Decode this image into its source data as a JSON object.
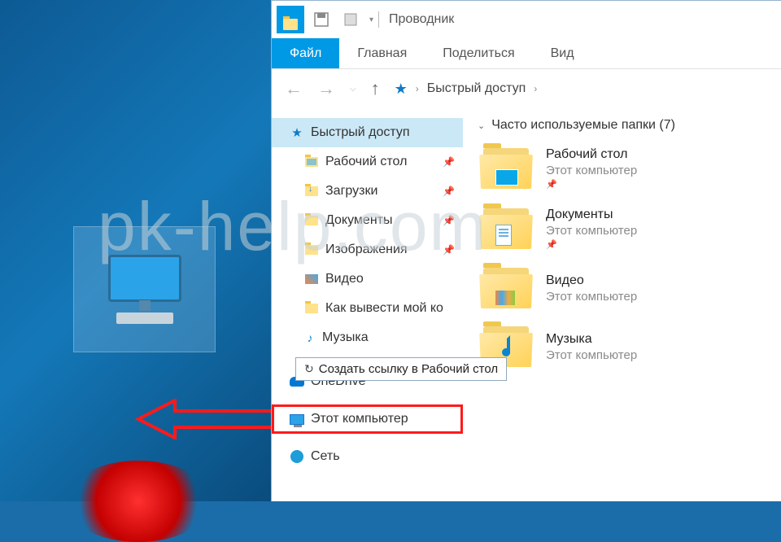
{
  "watermark": "pk-help.com",
  "titlebar": {
    "app_title": "Проводник"
  },
  "ribbon": {
    "file": "Файл",
    "home": "Главная",
    "share": "Поделиться",
    "view": "Вид"
  },
  "breadcrumb": {
    "root": "Быстрый доступ"
  },
  "navtree": {
    "quick_access": "Быстрый доступ",
    "desktop": "Рабочий стол",
    "downloads": "Загрузки",
    "documents": "Документы",
    "pictures": "Изображения",
    "videos": "Видео",
    "how_to": "Как вывести мой ко",
    "music": "Музыка",
    "onedrive": "OneDrive",
    "this_pc": "Этот компьютер",
    "network": "Сеть"
  },
  "shortcut_tooltip": "Создать ссылку в Рабочий стол",
  "content": {
    "group_label": "Часто используемые папки (7)",
    "items": [
      {
        "name": "Рабочий стол",
        "location": "Этот компьютер"
      },
      {
        "name": "Документы",
        "location": "Этот компьютер"
      },
      {
        "name": "Видео",
        "location": "Этот компьютер"
      },
      {
        "name": "Музыка",
        "location": "Этот компьютер"
      }
    ]
  }
}
